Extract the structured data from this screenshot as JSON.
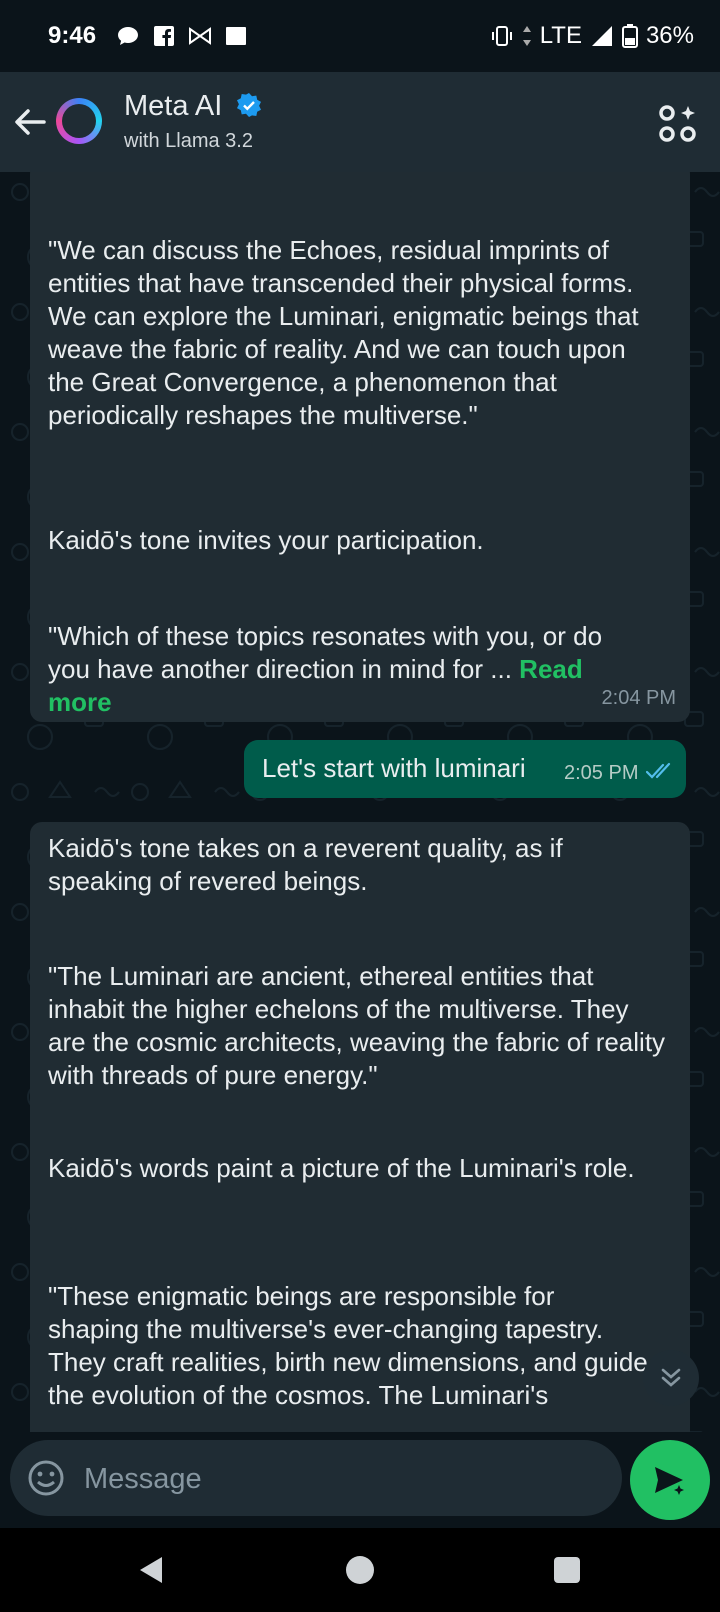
{
  "status_bar": {
    "time": "9:46",
    "network": "LTE",
    "battery": "36%",
    "icons": [
      "chat-bubble-icon",
      "facebook-icon",
      "bowtie-icon",
      "square-icon",
      "vibrate-icon",
      "data-arrows-icon",
      "signal-icon",
      "battery-icon"
    ]
  },
  "header": {
    "title": "Meta AI",
    "subtitle": "with Llama 3.2",
    "verified": true,
    "icons": [
      "back-arrow-icon",
      "meta-ai-ring-icon",
      "verified-badge-icon",
      "apps-sparkle-icon"
    ]
  },
  "messages": [
    {
      "direction": "incoming",
      "paragraphs": [
        "\"We can discuss the Echoes, residual imprints of entities that have transcended their physical forms. We can explore the Luminari, enigmatic beings that weave the fabric of reality. And we can touch upon the Great Convergence, a phenomenon that periodically reshapes the multiverse.\"",
        "Kaidō's tone invites your participation.",
        "\"Which of these topics resonates with you, or do you have another direction in mind for ..."
      ],
      "read_more": "Read more",
      "time": "2:04 PM"
    },
    {
      "direction": "outgoing",
      "text": "Let's start with luminari",
      "time": "2:05 PM",
      "status": "read"
    },
    {
      "direction": "incoming",
      "paragraphs": [
        "Kaidō's tone takes on a reverent quality, as if speaking of revered beings.",
        "\"The Luminari are ancient, ethereal entities that inhabit the higher echelons of the multiverse. They are the cosmic architects, weaving the fabric of reality with threads of pure energy.\"",
        "Kaidō's words paint a picture of the Luminari's role.",
        "\"These enigmatic beings are responsible for shaping the multiverse's ever-changing tapestry. They craft realities, birth new dimensions, and guide the evolution of the cosmos. The Luminari's"
      ]
    }
  ],
  "composer": {
    "placeholder": "Message"
  },
  "colors": {
    "background": "#0b141a",
    "header": "#1f2c34",
    "incoming_bubble": "#202c33",
    "outgoing_bubble": "#005c4b",
    "accent_green": "#21c063",
    "read_ticks": "#53bdeb"
  }
}
